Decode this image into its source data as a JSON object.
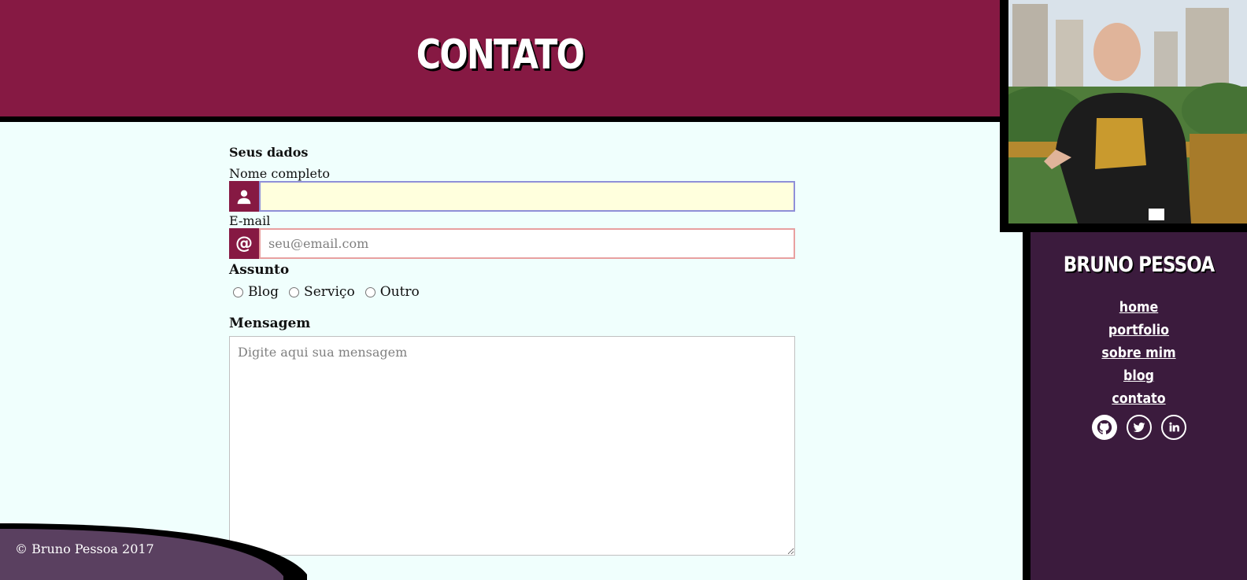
{
  "header": {
    "title": "CONTATO"
  },
  "sidebar": {
    "name": "BRUNO PESSOA",
    "nav": [
      {
        "label": "home"
      },
      {
        "label": "portfolio"
      },
      {
        "label": "sobre mim"
      },
      {
        "label": "blog"
      },
      {
        "label": "contato"
      }
    ],
    "socials": [
      "github-icon",
      "twitter-icon",
      "linkedin-icon"
    ]
  },
  "form": {
    "section_title": "Seus dados",
    "name_label": "Nome completo",
    "name_value": "",
    "email_label": "E-mail",
    "email_placeholder": "seu@email.com",
    "email_value": "",
    "subject_label": "Assunto",
    "subject_options": [
      "Blog",
      "Serviço",
      "Outro"
    ],
    "message_label": "Mensagem",
    "message_placeholder": "Digite aqui sua mensagem"
  },
  "footer": {
    "copyright": "© Bruno Pessoa 2017"
  },
  "colors": {
    "header": "#861943",
    "sidebar": "#3b1b3d",
    "page": "#f0fffd",
    "footer": "#5a4060"
  }
}
